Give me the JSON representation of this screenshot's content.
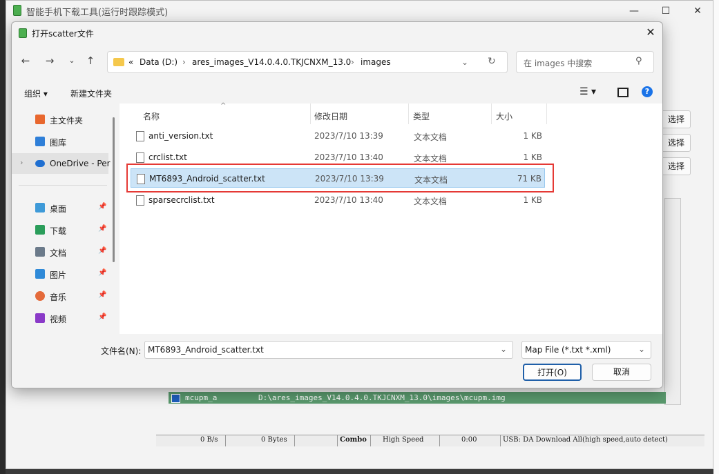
{
  "app": {
    "title": "智能手机下载工具(运行时跟踪模式)",
    "choose_labels": [
      "选择",
      "选择",
      "选择"
    ],
    "green_row": {
      "name": "mcupm_a",
      "path": "D:\\ares_images_V14.0.4.0.TKJCNXM_13.0\\images\\mcupm.img"
    },
    "status": {
      "speed": "0 B/s",
      "bytes": "0 Bytes",
      "mode": "Combo",
      "speed_mode": "High Speed",
      "time": "0:00",
      "usb": "USB: DA Download All(high speed,auto detect)"
    }
  },
  "dialog": {
    "title": "打开scatter文件",
    "close": "✕",
    "address": {
      "chevrons": "«",
      "segments": [
        "Data (D:)",
        "ares_images_V14.0.4.0.TKJCNXM_13.0",
        "images"
      ]
    },
    "search_placeholder": "在 images 中搜索",
    "toolbar": {
      "organize": "组织 ▾",
      "new_folder": "新建文件夹"
    },
    "nav": [
      {
        "label": "主文件夹",
        "icon": "home-icon",
        "color": "#e8672e"
      },
      {
        "label": "图库",
        "icon": "gallery-icon",
        "color": "#2f7fd8"
      },
      {
        "label": "OneDrive - Per",
        "icon": "cloud-icon",
        "color": "#1f6fd1"
      },
      {
        "label": "桌面",
        "icon": "desktop-icon",
        "color": "#3e9ad8"
      },
      {
        "label": "下载",
        "icon": "download-icon",
        "color": "#2a9d5a"
      },
      {
        "label": "文档",
        "icon": "document-icon",
        "color": "#6b7a8a"
      },
      {
        "label": "图片",
        "icon": "picture-icon",
        "color": "#2f8ad8"
      },
      {
        "label": "音乐",
        "icon": "music-icon",
        "color": "#e46a3a"
      },
      {
        "label": "视频",
        "icon": "video-icon",
        "color": "#8a3ac8"
      }
    ],
    "columns": {
      "name": "名称",
      "modified": "修改日期",
      "type": "类型",
      "size": "大小"
    },
    "files": [
      {
        "name": "anti_version.txt",
        "modified": "2023/7/10 13:39",
        "type": "文本文档",
        "size": "1 KB"
      },
      {
        "name": "crclist.txt",
        "modified": "2023/7/10 13:40",
        "type": "文本文档",
        "size": "1 KB"
      },
      {
        "name": "MT6893_Android_scatter.txt",
        "modified": "2023/7/10 13:39",
        "type": "文本文档",
        "size": "71 KB"
      },
      {
        "name": "sparsecrclist.txt",
        "modified": "2023/7/10 13:40",
        "type": "文本文档",
        "size": "1 KB"
      }
    ],
    "filename_label": "文件名(N):",
    "filename_value": "MT6893_Android_scatter.txt",
    "filter": "Map File (*.txt *.xml)",
    "open_button": "打开(O)",
    "cancel_button": "取消"
  }
}
